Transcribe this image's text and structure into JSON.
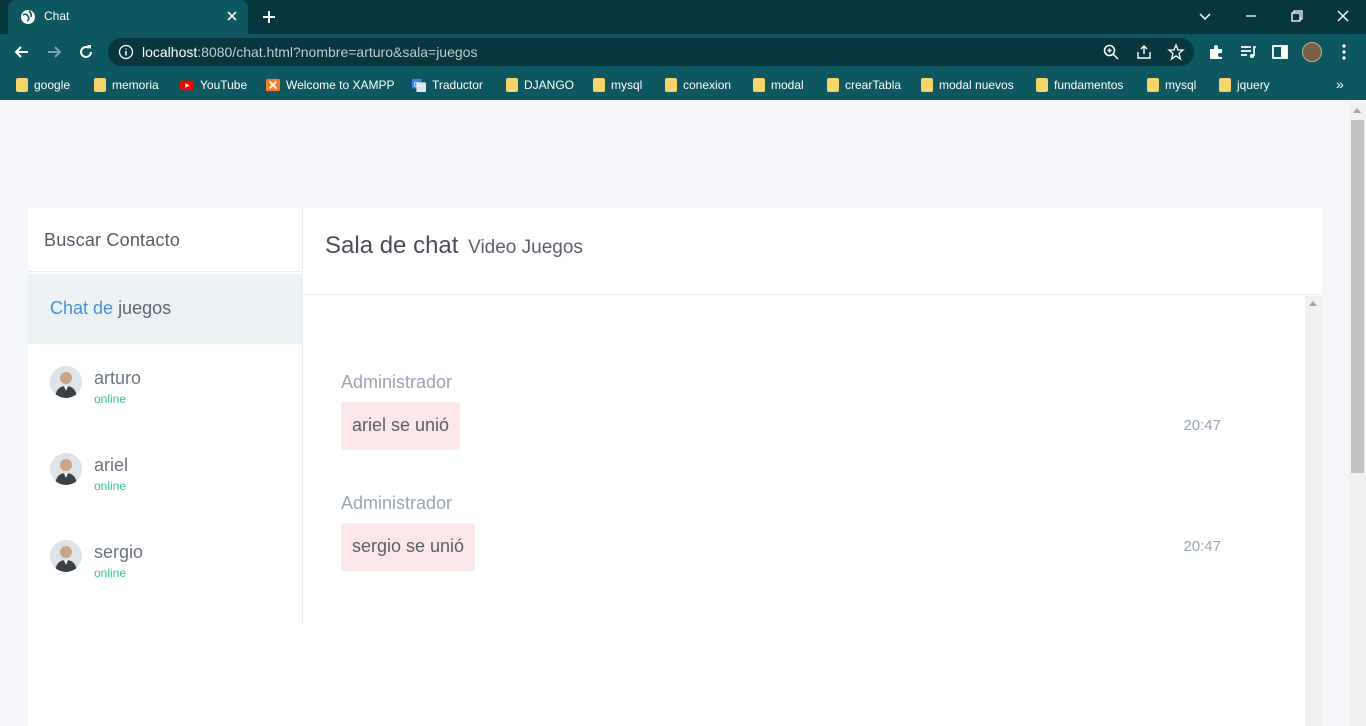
{
  "browser": {
    "tab_title": "Chat",
    "url_host": "localhost",
    "url_rest": ":8080/chat.html?nombre=arturo&sala=juegos",
    "bookmarks": [
      {
        "label": "google",
        "icon": "folder-icon"
      },
      {
        "label": "memoria",
        "icon": "folder-icon"
      },
      {
        "label": "YouTube",
        "icon": "youtube-icon"
      },
      {
        "label": "Welcome to XAMPP",
        "icon": "xampp-icon"
      },
      {
        "label": "Traductor",
        "icon": "translate-icon"
      },
      {
        "label": "DJANGO",
        "icon": "folder-icon"
      },
      {
        "label": "mysql",
        "icon": "folder-icon"
      },
      {
        "label": "conexion",
        "icon": "folder-icon"
      },
      {
        "label": "modal",
        "icon": "folder-icon"
      },
      {
        "label": "crearTabla",
        "icon": "folder-icon"
      },
      {
        "label": "modal nuevos",
        "icon": "folder-icon"
      },
      {
        "label": "fundamentos",
        "icon": "folder-icon"
      },
      {
        "label": "mysql",
        "icon": "folder-icon"
      },
      {
        "label": "jquery",
        "icon": "folder-icon"
      }
    ],
    "bookmarks_more": "»"
  },
  "sidebar": {
    "search_label": "Buscar Contacto",
    "room_prefix": "Chat de",
    "room_name": "juegos",
    "contacts": [
      {
        "name": "arturo",
        "status": "online"
      },
      {
        "name": "ariel",
        "status": "online"
      },
      {
        "name": "sergio",
        "status": "online"
      }
    ]
  },
  "chat": {
    "title": "Sala de chat",
    "subtitle": "Video Juegos",
    "messages": [
      {
        "author": "Administrador",
        "text": "ariel se unió",
        "time": "20:47"
      },
      {
        "author": "Administrador",
        "text": "sergio se unió",
        "time": "20:47"
      }
    ]
  },
  "colors": {
    "chrome_dark": "#07363f",
    "chrome": "#0e5660",
    "accent_blue": "#4a90d9",
    "online_green": "#2ec4a0",
    "bubble_pink": "#fbe7ea"
  }
}
